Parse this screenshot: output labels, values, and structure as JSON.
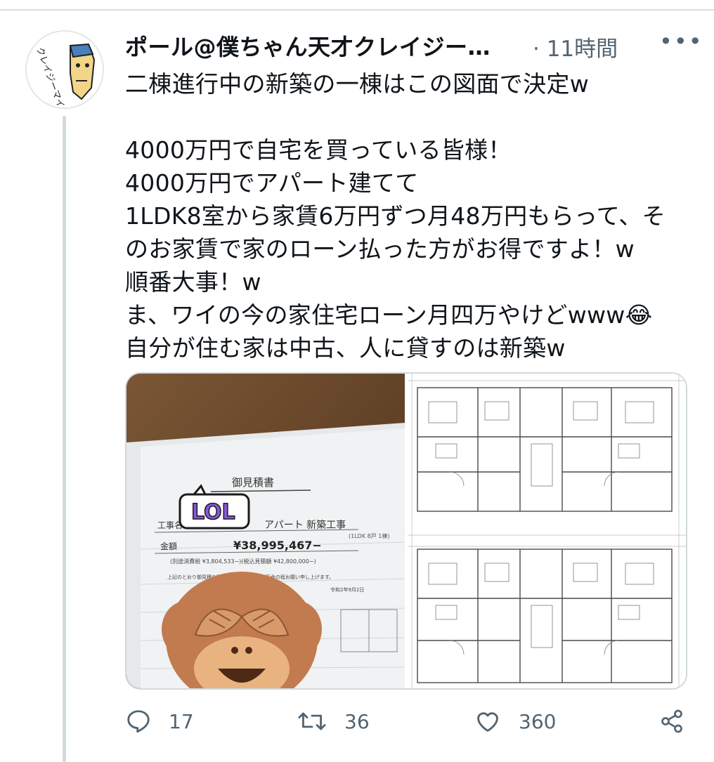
{
  "tweet": {
    "author_name": "ポール@僕ちゃん天才クレイジー…",
    "time": "· 11時間",
    "more": "•••",
    "text": "二棟進行中の新築の一棟はこの図面で決定w\n\n4000万円で自宅を買っている皆様！\n4000万円でアパート建てて\n1LDK8室から家賃6万円ずつ月48万円もらって、そのお家賃で家のローン払った方がお得ですよ！w\n順番大事！w\nま、ワイの今の家住宅ローン月四万やけどwww😂\n自分が住む家は中古、人に貸すのは新築w",
    "avatar_text": "クレイジーマインド!!"
  },
  "estimate_document": {
    "title": "御見積書",
    "sticker_text": "LOL",
    "label_project": "工事名",
    "project_name": "アパート 新築工事",
    "project_sub": "(1LDK 8戸 1棟)",
    "label_amount": "金額",
    "amount": "¥38,995,467−",
    "tax_line": "(別途消費税 ¥3,804,533−)(税込見積額 ¥42,800,000−)",
    "note": "上記のとおり御見積り致しましたので何卒ご下命の程お願い申し上げます。",
    "date": "令和2年9月2日"
  },
  "actions": {
    "reply_count": "17",
    "retweet_count": "36",
    "like_count": "360"
  },
  "colors": {
    "text": "#0f1419",
    "secondary": "#536471",
    "border": "#cfd9de",
    "monkey": "#c27b4e",
    "sticker_purple": "#8a55e0"
  }
}
